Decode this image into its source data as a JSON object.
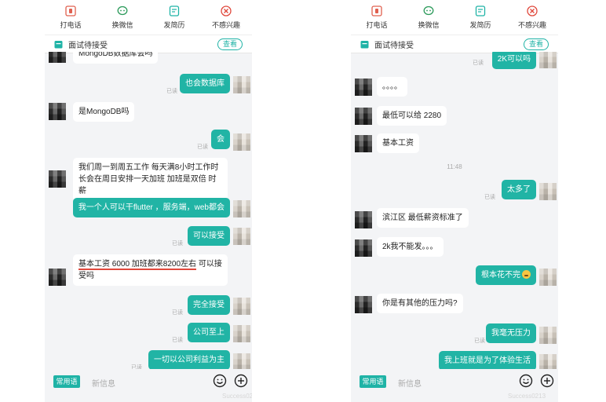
{
  "top_actions": [
    {
      "label": "打电话",
      "icon": "phone-icon"
    },
    {
      "label": "换微信",
      "icon": "wechat-icon"
    },
    {
      "label": "发简历",
      "icon": "resume-icon"
    },
    {
      "label": "不感兴趣",
      "icon": "not-interested-icon"
    }
  ],
  "banner": {
    "title": "面试待接受",
    "view_label": "查看"
  },
  "bottom_bar": {
    "quick_phrases": "常用语",
    "input_placeholder": "新信息"
  },
  "colors": {
    "accent": "#1fb3a6",
    "outgoing_bubble": "#21b4a5",
    "underline": "#e0483c"
  },
  "read_label": "已读",
  "left_chat": {
    "messages": [
      {
        "side": "in",
        "text": "MongoDB数据库会吗"
      },
      {
        "side": "out",
        "text": "也会数据库"
      },
      {
        "side": "in",
        "text": "是MongoDB吗"
      },
      {
        "side": "out",
        "text": "会"
      },
      {
        "side": "in",
        "text": "我们周一到周五工作 每天满8小时工作时长会在周日安排一天加班  加班是双倍 时薪"
      },
      {
        "side": "out",
        "text": "我一个人可以干flutter ，服务端，web都会"
      },
      {
        "side": "out",
        "text": "可以接受"
      },
      {
        "side": "in",
        "text_underlined": "基本工资 6000 加班都来8200左右",
        "text_rest": " 可以接受吗"
      },
      {
        "side": "out",
        "text": "完全接受"
      },
      {
        "side": "out",
        "text": "公司至上"
      },
      {
        "side": "out",
        "text": "一切以公司利益为主"
      }
    ]
  },
  "right_chat": {
    "time_divider": "11:48",
    "messages": [
      {
        "side": "out",
        "text": "2K可以吗"
      },
      {
        "side": "in",
        "text": "。。。。"
      },
      {
        "side": "in",
        "text": "最低可以给 2280"
      },
      {
        "side": "in",
        "text": "基本工资"
      },
      {
        "side": "out",
        "text": "太多了"
      },
      {
        "side": "in",
        "text": "滨江区 最低薪资标准了"
      },
      {
        "side": "in",
        "text": "2k我不能发。。。"
      },
      {
        "side": "out",
        "text": "根本花不完"
      },
      {
        "side": "in",
        "text": "你是有其他的压力吗?"
      },
      {
        "side": "out",
        "text": "我毫无压力"
      },
      {
        "side": "out",
        "text": "我上班就是为了体验生活"
      }
    ]
  },
  "watermark": "Success0213"
}
